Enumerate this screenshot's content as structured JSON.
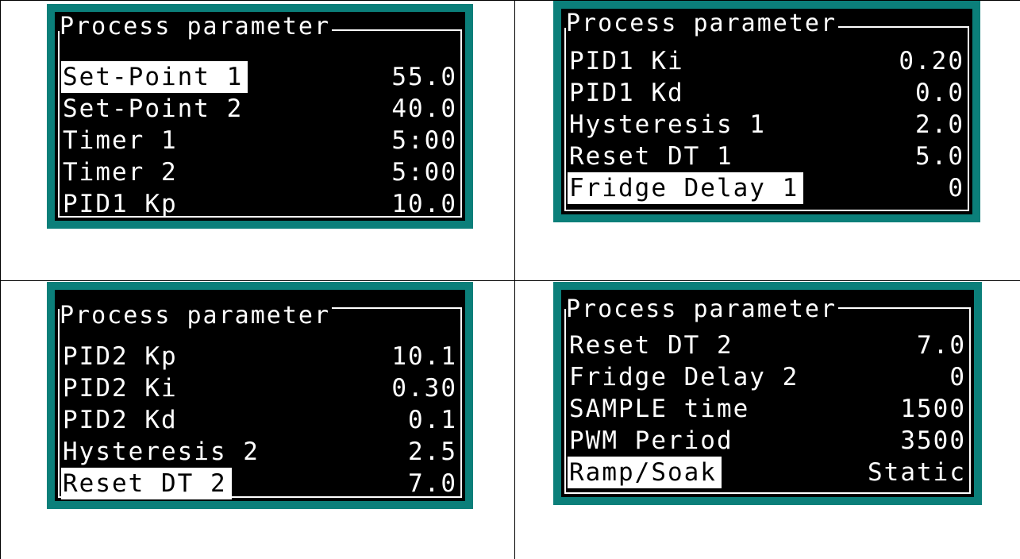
{
  "panels": [
    {
      "title": "Process parameter",
      "rows": [
        {
          "label": "Set-Point 1",
          "value": "55.0",
          "selected": true
        },
        {
          "label": "Set-Point 2",
          "value": "40.0",
          "selected": false
        },
        {
          "label": "Timer 1",
          "value": "5:00",
          "selected": false
        },
        {
          "label": "Timer 2",
          "value": "5:00",
          "selected": false
        },
        {
          "label": "PID1 Kp",
          "value": "10.0",
          "selected": false
        }
      ]
    },
    {
      "title": "Process parameter",
      "rows": [
        {
          "label": "PID1 Ki",
          "value": "0.20",
          "selected": false
        },
        {
          "label": "PID1 Kd",
          "value": "0.0",
          "selected": false
        },
        {
          "label": "Hysteresis 1",
          "value": "2.0",
          "selected": false
        },
        {
          "label": "Reset DT 1",
          "value": "5.0",
          "selected": false
        },
        {
          "label": "Fridge Delay 1",
          "value": "0",
          "selected": true
        }
      ]
    },
    {
      "title": "Process parameter",
      "rows": [
        {
          "label": "PID2 Kp",
          "value": "10.1",
          "selected": false
        },
        {
          "label": "PID2 Ki",
          "value": "0.30",
          "selected": false
        },
        {
          "label": "PID2 Kd",
          "value": "0.1",
          "selected": false
        },
        {
          "label": "Hysteresis 2",
          "value": "2.5",
          "selected": false
        },
        {
          "label": "Reset DT 2",
          "value": "7.0",
          "selected": true
        }
      ]
    },
    {
      "title": "Process parameter",
      "rows": [
        {
          "label": "Reset DT 2",
          "value": "7.0",
          "selected": false
        },
        {
          "label": "Fridge Delay 2",
          "value": "0",
          "selected": false
        },
        {
          "label": "SAMPLE time",
          "value": "1500",
          "selected": false
        },
        {
          "label": "PWM Period",
          "value": "3500",
          "selected": false
        },
        {
          "label": "Ramp/Soak",
          "value": "Static",
          "selected": true
        }
      ]
    }
  ],
  "colors": {
    "frame": "#0b7f7a",
    "screen": "#000000",
    "text": "#ffffff"
  }
}
